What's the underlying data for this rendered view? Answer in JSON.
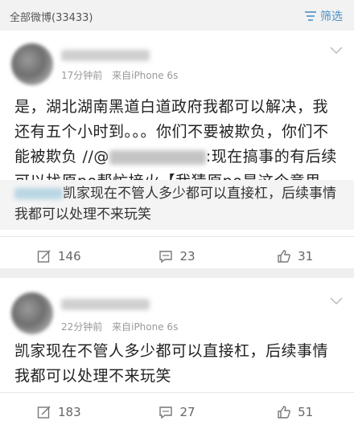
{
  "topbar": {
    "all_weibo": "全部微博(33433)",
    "filter_label": "筛选",
    "filter_icon": "filter-icon"
  },
  "posts": [
    {
      "time": "17分钟前",
      "source": "来自iPhone 6s",
      "text_part1": "是，湖北湖南黑道白道政府我都可以解决，我还有五个小时到。。。你们不要被欺负，你们不能被欺负 //@",
      "text_part2": ":现在搞事的有后续可以找原po帮忙接火【我猜原po是这个意思",
      "repost_text": "凯家现在不管人多少都可以直接杠，后续事情我都可以处理不来玩笑",
      "reposts": "146",
      "comments": "23",
      "likes": "31"
    },
    {
      "time": "22分钟前",
      "source": "来自iPhone 6s",
      "text": "凯家现在不管人多少都可以直接杠，后续事情我都可以处理不来玩笑",
      "reposts": "183",
      "comments": "27",
      "likes": "51"
    }
  ],
  "colors": {
    "accent": "#4a90c8",
    "background": "#efefef",
    "card": "#ffffff"
  }
}
